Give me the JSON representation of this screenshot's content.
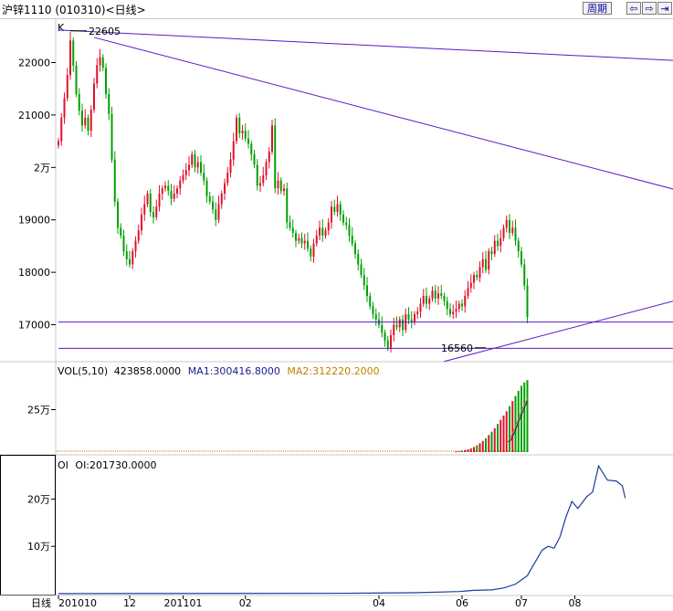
{
  "header": {
    "title": "沪锌1110 (010310)<日线>",
    "period_label": "周期",
    "nav": {
      "prev": "⇦",
      "next": "⇨",
      "end": "⇥"
    }
  },
  "colors": {
    "up": "#e0102a",
    "down": "#00a000",
    "trend": "#5a18c8",
    "ma2": "#c08000",
    "oi": "#1c3c9c"
  },
  "chart_data": [
    {
      "type": "candlestick",
      "name_label": "K",
      "y_ticks": [
        {
          "v": 22000,
          "label": "22000"
        },
        {
          "v": 21000,
          "label": "21000"
        },
        {
          "v": 20000,
          "label": "2万"
        },
        {
          "v": 19000,
          "label": "19000"
        },
        {
          "v": 18000,
          "label": "18000"
        },
        {
          "v": 17000,
          "label": "17000"
        }
      ],
      "ylim": [
        16330,
        22740
      ],
      "annotations": [
        {
          "label": "22605",
          "bar": 4,
          "value": 22605
        },
        {
          "label": "16560",
          "bar": 144,
          "value": 16560
        }
      ],
      "series_close": [
        20500,
        20950,
        21320,
        21760,
        22420,
        21940,
        21400,
        21080,
        20800,
        20950,
        20700,
        21100,
        21600,
        21950,
        22100,
        21900,
        21400,
        21020,
        20150,
        19350,
        18850,
        18700,
        18400,
        18250,
        18150,
        18400,
        18600,
        18800,
        19100,
        19300,
        19500,
        19150,
        19050,
        19250,
        19500,
        19600,
        19650,
        19550,
        19400,
        19500,
        19600,
        19750,
        19850,
        19950,
        20050,
        20250,
        20000,
        20100,
        19900,
        19750,
        19450,
        19350,
        19200,
        19000,
        19300,
        19500,
        19700,
        19900,
        20150,
        20500,
        20950,
        20650,
        20700,
        20550,
        20450,
        20250,
        20050,
        19650,
        19700,
        19850,
        20100,
        20300,
        20800,
        19600,
        19750,
        19550,
        19600,
        18950,
        18850,
        18750,
        18600,
        18650,
        18550,
        18600,
        18450,
        18300,
        18550,
        18700,
        18850,
        18700,
        18800,
        18950,
        19250,
        19150,
        19300,
        19100,
        18950,
        18900,
        18700,
        18550,
        18350,
        18150,
        17950,
        17750,
        17550,
        17350,
        17200,
        17100,
        17000,
        16850,
        16700,
        16560,
        16800,
        17000,
        16950,
        17100,
        16900,
        17200,
        17100,
        17050,
        17200,
        17250,
        17400,
        17550,
        17400,
        17500,
        17650,
        17500,
        17600,
        17550,
        17450,
        17300,
        17200,
        17250,
        17300,
        17400,
        17350,
        17550,
        17700,
        17800,
        17950,
        17900,
        18100,
        18250,
        18050,
        18400,
        18350,
        18600,
        18500,
        18650,
        18850,
        19000,
        18750,
        18850,
        18600,
        18400,
        18150,
        17750,
        17150
      ],
      "trendlines": [
        {
          "p1": [
            0,
            22620
          ],
          "p2": [
            240,
            21950
          ]
        },
        {
          "p1": [
            12,
            22480
          ],
          "p2": [
            240,
            19100
          ]
        },
        {
          "p1": [
            130,
            16300
          ],
          "p2": [
            240,
            17940
          ]
        },
        {
          "p1": [
            0,
            17050
          ],
          "p2": [
            240,
            17050
          ]
        },
        {
          "p1": [
            0,
            16550
          ],
          "p2": [
            240,
            16550
          ]
        }
      ]
    },
    {
      "type": "bar",
      "legend": {
        "name": "VOL(5,10)",
        "value": "423858.0000",
        "ma1": "MA1:300416.8000",
        "ma2": "MA2:312220.2000"
      },
      "y_ticks": [
        {
          "v": 250000,
          "label": "25万"
        }
      ],
      "ylim": [
        0,
        430000
      ],
      "series": [
        {
          "name": "VOL",
          "values_tail": [
            4000,
            6000,
            9000,
            12000,
            16000,
            22000,
            30000,
            40000,
            52000,
            66000,
            82000,
            100000,
            120000,
            140000,
            165000,
            190000,
            215000,
            240000,
            270000,
            300000,
            330000,
            360000,
            390000,
            410000,
            423858
          ]
        },
        {
          "name": "MA1",
          "values_tail": [
            60000,
            90000,
            130000,
            175000,
            220000,
            260000,
            300416
          ]
        },
        {
          "name": "MA2",
          "values_tail": [
            50000,
            75000,
            110000,
            150000,
            195000,
            240000,
            280000,
            312220
          ]
        }
      ]
    },
    {
      "type": "line",
      "legend": {
        "name": "OI",
        "value": "OI:201730.0000"
      },
      "y_ticks": [
        {
          "v": 200000,
          "label": "20万"
        },
        {
          "v": 100000,
          "label": "10万"
        }
      ],
      "ylim": [
        0,
        280000
      ],
      "series": [
        {
          "name": "OI",
          "points": [
            [
              0,
              0
            ],
            [
              100,
              900
            ],
            [
              120,
              2000
            ],
            [
              135,
              4500
            ],
            [
              140,
              7000
            ],
            [
              146,
              8000
            ],
            [
              150,
              12000
            ],
            [
              154,
              20000
            ],
            [
              158,
              38000
            ],
            [
              160,
              60000
            ],
            [
              163,
              92000
            ],
            [
              165,
              100000
            ],
            [
              167,
              96000
            ],
            [
              169,
              120000
            ],
            [
              171,
              162000
            ],
            [
              173,
              195000
            ],
            [
              175,
              180000
            ],
            [
              178,
              205000
            ],
            [
              180,
              215000
            ],
            [
              182,
              270000
            ],
            [
              185,
              240000
            ],
            [
              188,
              238000
            ],
            [
              190,
              228000
            ],
            [
              191,
              201730
            ]
          ]
        }
      ]
    }
  ],
  "x_axis": {
    "corner_label": "日线",
    "ticks": [
      {
        "bar": 0,
        "label": "201010"
      },
      {
        "bar": 24,
        "label": "12"
      },
      {
        "bar": 42,
        "label": "201101"
      },
      {
        "bar": 63,
        "label": "02"
      },
      {
        "bar": 108,
        "label": "04"
      },
      {
        "bar": 136,
        "label": "06"
      },
      {
        "bar": 156,
        "label": "07"
      },
      {
        "bar": 174,
        "label": "08"
      }
    ]
  }
}
